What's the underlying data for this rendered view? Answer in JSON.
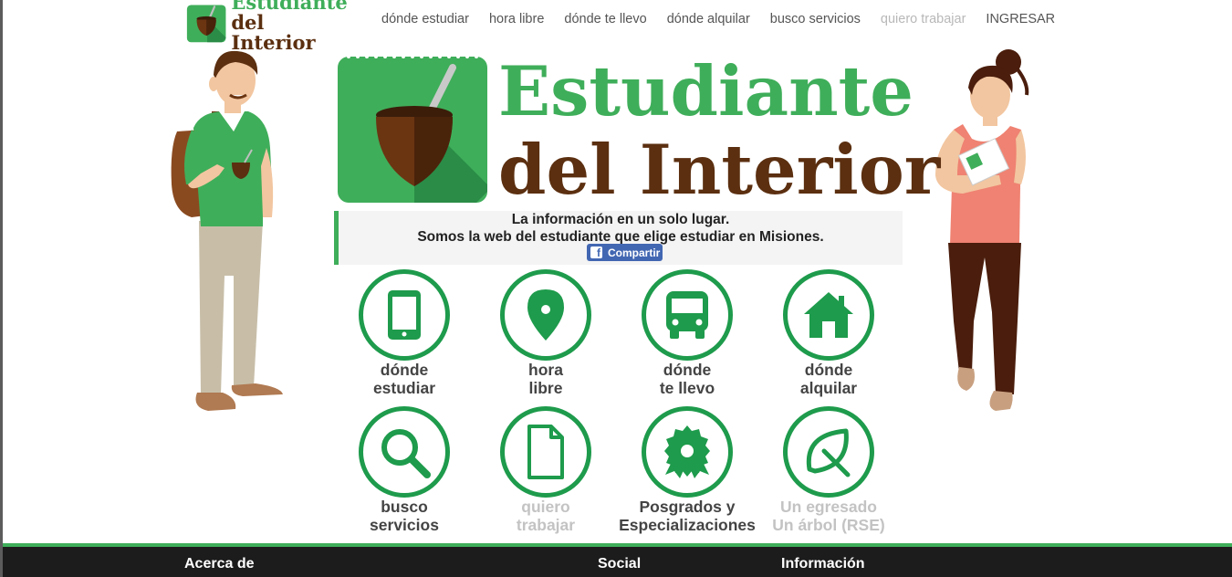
{
  "brand": {
    "line1": "Estudiante",
    "line2": "del Interior",
    "green": "#3fae5a",
    "brown": "#5b2f10"
  },
  "nav": {
    "links": [
      {
        "label": "dónde estudiar",
        "muted": false
      },
      {
        "label": "hora libre",
        "muted": false
      },
      {
        "label": "dónde te llevo",
        "muted": false
      },
      {
        "label": "dónde alquilar",
        "muted": false
      },
      {
        "label": "busco servicios",
        "muted": false
      },
      {
        "label": "quiero trabajar",
        "muted": true
      },
      {
        "label": "INGRESAR",
        "muted": false
      }
    ]
  },
  "tagline": {
    "line1": "La información en un solo lugar.",
    "line2": "Somos la web del estudiante que elige estudiar en Misiones."
  },
  "share": {
    "label": "Compartir",
    "icon": "facebook-icon",
    "color": "#4267b2"
  },
  "tiles": [
    {
      "label": "dónde\nestudiar",
      "icon": "smartphone-icon",
      "muted": false
    },
    {
      "label": "hora\nlibre",
      "icon": "map-pin-icon",
      "muted": false
    },
    {
      "label": "dónde\nte llevo",
      "icon": "bus-icon",
      "muted": false
    },
    {
      "label": "dónde\nalquilar",
      "icon": "house-icon",
      "muted": false
    },
    {
      "label": "busco\nservicios",
      "icon": "search-icon",
      "muted": false
    },
    {
      "label": "quiero\ntrabajar",
      "icon": "document-icon",
      "muted": true
    },
    {
      "label": "Posgrados y\nEspecializaciones",
      "icon": "award-badge-icon",
      "muted": false
    },
    {
      "label": "Un egresado\nUn árbol (RSE)",
      "icon": "leaf-icon",
      "muted": true
    }
  ],
  "footer": {
    "about": "Acerca de",
    "social": "Social",
    "info": "Información"
  },
  "colors": {
    "icon_ring": "#1e9b4c",
    "footer_bg": "#1c1c1c"
  }
}
